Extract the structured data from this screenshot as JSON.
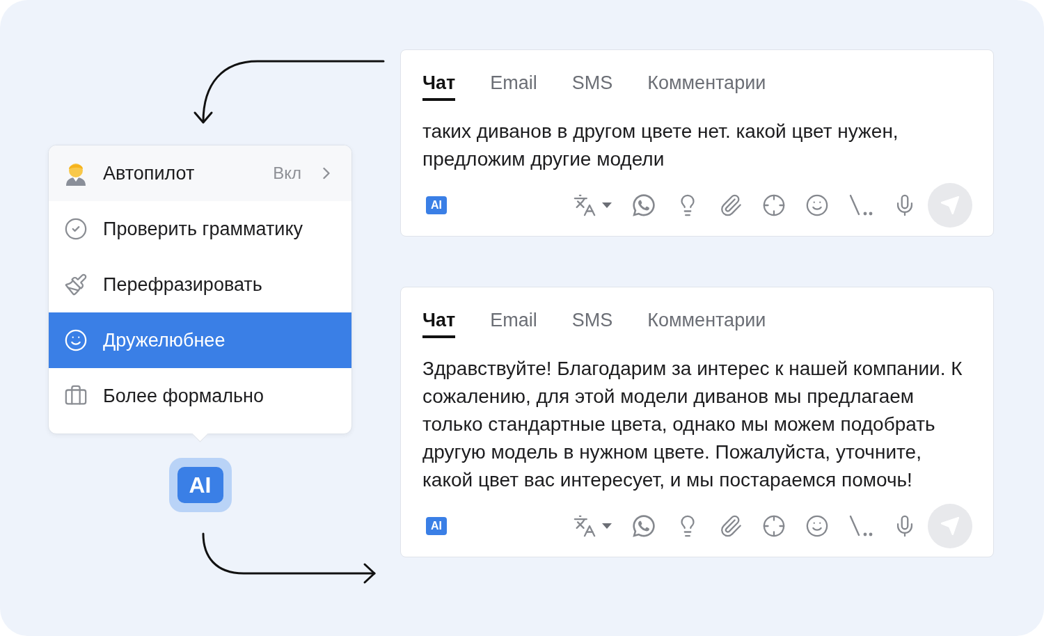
{
  "menu": {
    "items": [
      {
        "label": "Автопилот",
        "value": "Вкл",
        "selected": false
      },
      {
        "label": "Проверить грамматику",
        "selected": false
      },
      {
        "label": "Перефразировать",
        "selected": false
      },
      {
        "label": "Дружелюбнее",
        "selected": true
      },
      {
        "label": "Более формально",
        "selected": false
      }
    ]
  },
  "ai_button": {
    "label": "AI"
  },
  "composers": [
    {
      "tabs": [
        {
          "label": "Чат",
          "selected": true
        },
        {
          "label": "Email",
          "selected": false
        },
        {
          "label": "SMS",
          "selected": false
        },
        {
          "label": "Комментарии",
          "selected": false
        }
      ],
      "message": "таких диванов в другом цвете нет. какой цвет нужен, предложим другие модели",
      "ai_badge": "AI",
      "send_disabled": true
    },
    {
      "tabs": [
        {
          "label": "Чат",
          "selected": true
        },
        {
          "label": "Email",
          "selected": false
        },
        {
          "label": "SMS",
          "selected": false
        },
        {
          "label": "Комментарии",
          "selected": false
        }
      ],
      "message": "Здравствуйте! Благодарим за интерес к нашей компании. К сожалению, для этой модели диванов мы предлагаем только стандартные цвета, однако мы можем подобрать другую модель в нужном цвете. Пожалуйста, уточните, какой цвет вас интересует, и мы постараемся помочь!",
      "ai_badge": "AI",
      "send_disabled": true
    }
  ]
}
